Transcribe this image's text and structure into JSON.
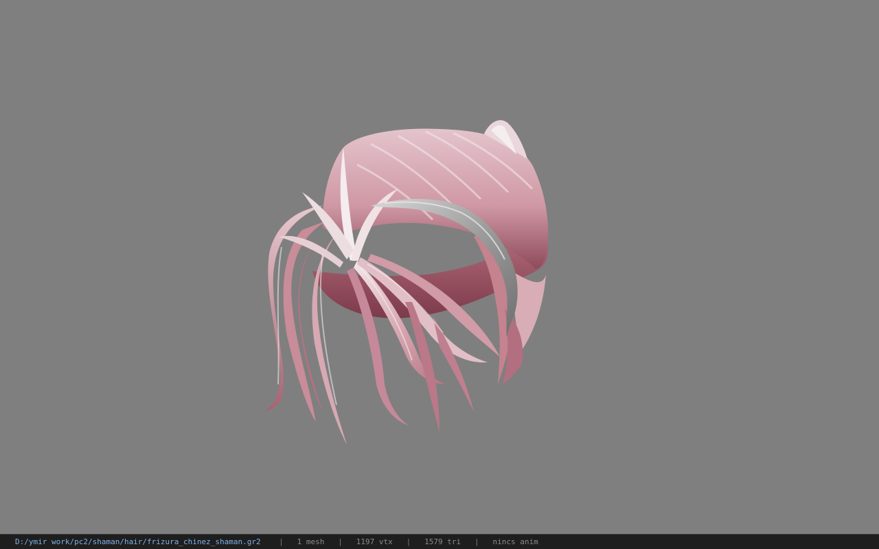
{
  "viewer": {
    "background_color": "#7f7f7f",
    "model_icon": "hair-mesh-icon",
    "hair_base_color": "#d4a3ad",
    "hair_highlight_color": "#efe3e6",
    "hair_shadow_color": "#9a5565",
    "band_color": "#a9a9a9"
  },
  "status": {
    "path": "D:/ymir work/pc2/shaman/hair/frizura_chinez_shaman.gr2",
    "separator": "|",
    "mesh": "1 mesh",
    "vertices": "1197 vtx",
    "triangles": "1579 tri",
    "anim": "nincs anim"
  }
}
